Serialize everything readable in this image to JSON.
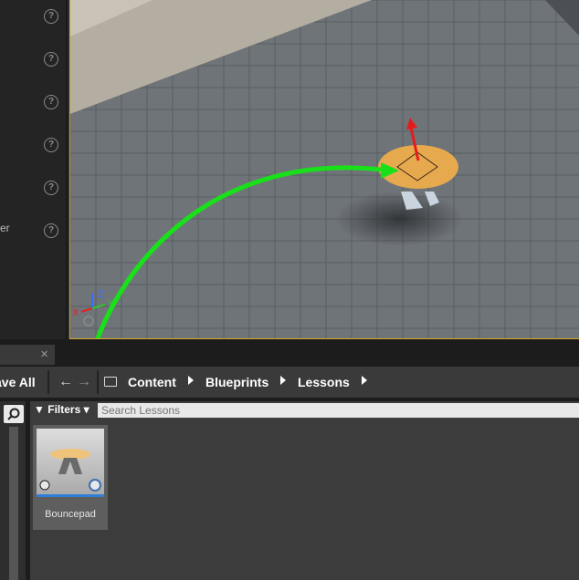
{
  "details_panel": {
    "partial_label": "er",
    "help_icons": [
      "help-icon",
      "help-icon",
      "help-icon",
      "help-icon",
      "help-icon",
      "help-icon"
    ]
  },
  "viewport": {
    "axis_labels": {
      "z": "Z",
      "y": "Y",
      "x": "X"
    }
  },
  "content_browser": {
    "save_all_label": "ave All",
    "breadcrumbs": [
      "Content",
      "Blueprints",
      "Lessons"
    ],
    "filters_label": "Filters",
    "search_placeholder": "Search Lessons",
    "assets": [
      {
        "name": "Bouncepad"
      }
    ]
  }
}
